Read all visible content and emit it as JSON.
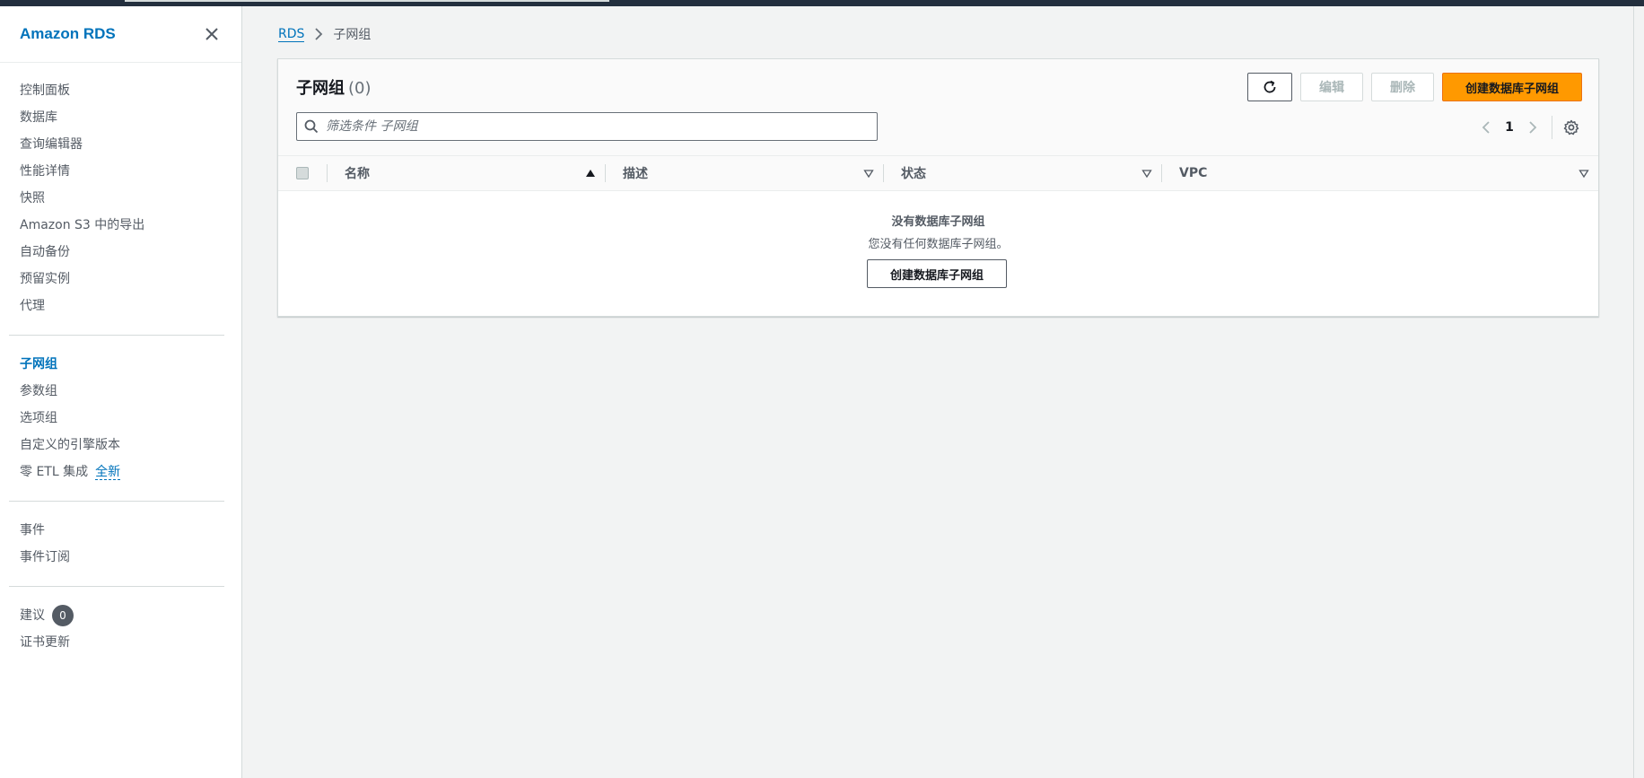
{
  "sidebar": {
    "title": "Amazon RDS",
    "group1": [
      "控制面板",
      "数据库",
      "查询编辑器",
      "性能详情",
      "快照",
      "Amazon S3 中的导出",
      "自动备份",
      "预留实例",
      "代理"
    ],
    "group2": [
      "子网组",
      "参数组",
      "选项组",
      "自定义的引擎版本"
    ],
    "zero_etl_label": "零 ETL 集成",
    "zero_etl_tag": "全新",
    "group3": [
      "事件",
      "事件订阅"
    ],
    "recommendations_label": "建议",
    "recommendations_count": "0",
    "cert_update": "证书更新"
  },
  "breadcrumb": {
    "root": "RDS",
    "current": "子网组"
  },
  "panel": {
    "title": "子网组",
    "count": "(0)",
    "edit_label": "编辑",
    "delete_label": "删除",
    "create_label": "创建数据库子网组",
    "search_placeholder": "筛选条件 子网组",
    "page": "1",
    "columns": [
      "名称",
      "描述",
      "状态",
      "VPC"
    ],
    "empty_title": "没有数据库子网组",
    "empty_desc": "您没有任何数据库子网组。",
    "empty_create_label": "创建数据库子网组"
  },
  "colors": {
    "link": "#0073bb",
    "primary_button": "#ff9900",
    "nav_bar": "#232f3e"
  }
}
